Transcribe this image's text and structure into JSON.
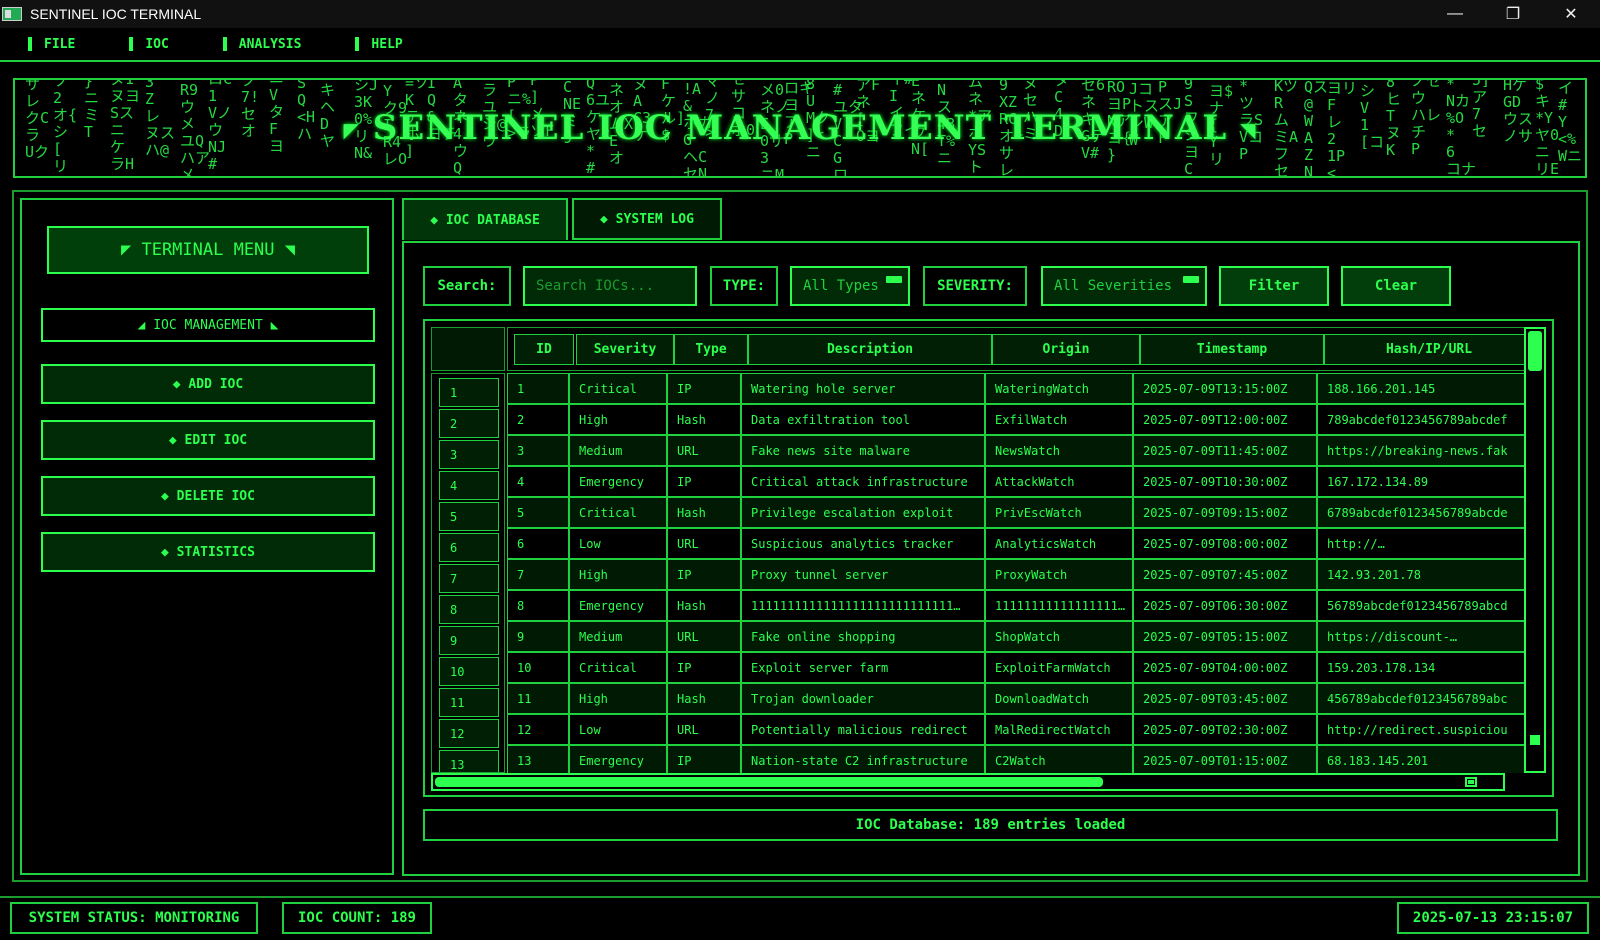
{
  "window": {
    "title": "SENTINEL IOC TERMINAL",
    "minimize": "—",
    "maximize": "❐",
    "close": "✕"
  },
  "menu": [
    "FILE",
    "IOC",
    "ANALYSIS",
    "HELP"
  ],
  "banner": {
    "title": "SENTINEL IOC MANAGEMENT TERMINAL",
    "left_corner": "◤",
    "right_corner": "◥"
  },
  "sidebar": {
    "title": "◤ TERMINAL MENU ◥",
    "section": "◢ IOC MANAGEMENT ◣",
    "buttons": [
      "◆ ADD IOC",
      "◆ EDIT IOC",
      "◆ DELETE IOC",
      "◆ STATISTICS"
    ]
  },
  "tabs": [
    "◆ IOC DATABASE",
    "◆ SYSTEM LOG"
  ],
  "filters": {
    "search_label": "Search:",
    "search_placeholder": "Search IOCs...",
    "type_label": "TYPE:",
    "type_value": "All Types",
    "severity_label": "SEVERITY:",
    "severity_value": "All Severities",
    "filter_button": "Filter",
    "clear_button": "Clear"
  },
  "table": {
    "columns": [
      "ID",
      "Severity",
      "Type",
      "Description",
      "Origin",
      "Timestamp",
      "Hash/IP/URL"
    ],
    "rows": [
      [
        "1",
        "Critical",
        "IP",
        "Watering hole server",
        "WateringWatch",
        "2025-07-09T13:15:00Z",
        "188.166.201.145"
      ],
      [
        "2",
        "High",
        "Hash",
        "Data exfiltration tool",
        "ExfilWatch",
        "2025-07-09T12:00:00Z",
        "789abcdef0123456789abcdef"
      ],
      [
        "3",
        "Medium",
        "URL",
        "Fake news site malware",
        "NewsWatch",
        "2025-07-09T11:45:00Z",
        "https://breaking-news.fak"
      ],
      [
        "4",
        "Emergency",
        "IP",
        "Critical attack infrastructure",
        "AttackWatch",
        "2025-07-09T10:30:00Z",
        "167.172.134.89"
      ],
      [
        "5",
        "Critical",
        "Hash",
        "Privilege escalation exploit",
        "PrivEscWatch",
        "2025-07-09T09:15:00Z",
        "6789abcdef0123456789abcde"
      ],
      [
        "6",
        "Low",
        "URL",
        "Suspicious analytics tracker",
        "AnalyticsWatch",
        "2025-07-09T08:00:00Z",
        "http://…"
      ],
      [
        "7",
        "High",
        "IP",
        "Proxy tunnel server",
        "ProxyWatch",
        "2025-07-09T07:45:00Z",
        "142.93.201.78"
      ],
      [
        "8",
        "Emergency",
        "Hash",
        "1111111111111111111111111111…",
        "11111111111111111…",
        "2025-07-09T06:30:00Z",
        "56789abcdef0123456789abcd"
      ],
      [
        "9",
        "Medium",
        "URL",
        "Fake online shopping",
        "ShopWatch",
        "2025-07-09T05:15:00Z",
        "https://discount-…"
      ],
      [
        "10",
        "Critical",
        "IP",
        "Exploit server farm",
        "ExploitFarmWatch",
        "2025-07-09T04:00:00Z",
        "159.203.178.134"
      ],
      [
        "11",
        "High",
        "Hash",
        "Trojan downloader",
        "DownloadWatch",
        "2025-07-09T03:45:00Z",
        "456789abcdef0123456789abc"
      ],
      [
        "12",
        "Low",
        "URL",
        "Potentially malicious redirect",
        "MalRedirectWatch",
        "2025-07-09T02:30:00Z",
        "http://redirect.suspiciou"
      ],
      [
        "13",
        "Emergency",
        "IP",
        "Nation-state C2 infrastructure",
        "C2Watch",
        "2025-07-09T01:15:00Z",
        "68.183.145.201"
      ]
    ],
    "status": "IOC Database: 189 entries loaded"
  },
  "statusbar": {
    "system_status": "SYSTEM STATUS: MONITORING",
    "ioc_count": "IOC COUNT: 189",
    "clock": "2025-07-13 23:15:07"
  },
  "colors": {
    "accent": "#2cff4e",
    "background": "#000000",
    "panel": "#012b06"
  }
}
